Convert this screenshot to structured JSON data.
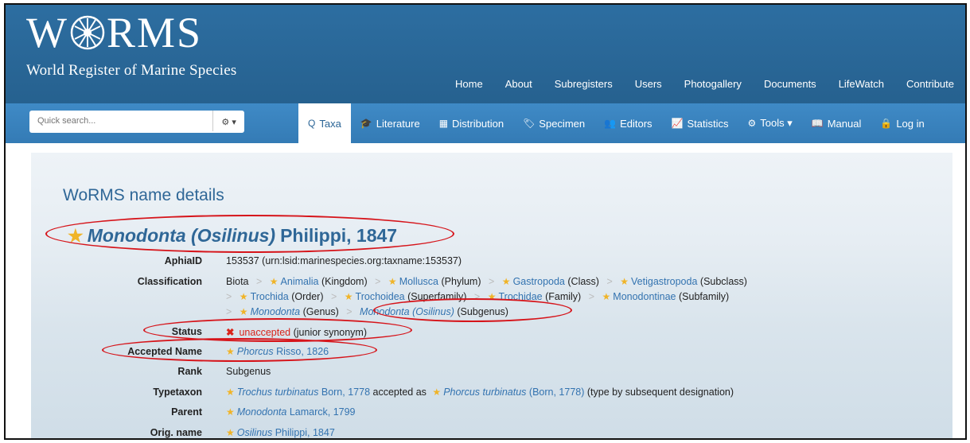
{
  "header": {
    "logo_word_left": "W",
    "logo_word_right": "RMS",
    "logo_subtitle": "World Register of Marine Species",
    "top_nav": [
      "Home",
      "About",
      "Subregisters",
      "Users",
      "Photogallery",
      "Documents",
      "LifeWatch",
      "Contribute"
    ]
  },
  "subnav": {
    "search_placeholder": "Quick search...",
    "gear": "⚙ ▾",
    "tabs": [
      {
        "icon": "Q",
        "label": "Taxa"
      },
      {
        "icon": "🎓",
        "label": "Literature"
      },
      {
        "icon": "▦",
        "label": "Distribution"
      },
      {
        "icon": "🏷",
        "label": "Specimen"
      },
      {
        "icon": "👥",
        "label": "Editors"
      },
      {
        "icon": "📈",
        "label": "Statistics"
      },
      {
        "icon": "⚙",
        "label": "Tools ▾"
      },
      {
        "icon": "📖",
        "label": "Manual"
      },
      {
        "icon": "🔒",
        "label": "Log in"
      }
    ]
  },
  "main": {
    "page_title": "WoRMS name details",
    "name_genus": "Monodonta (Osilinus)",
    "name_author": "Philippi, 1847",
    "aphia_label": "AphiaID",
    "aphia_value": "153537  (urn:lsid:marinespecies.org:taxname:153537)",
    "classification_label": "Classification",
    "classification": {
      "root": "Biota",
      "line1": [
        {
          "name": "Animalia",
          "rank": "(Kingdom)"
        },
        {
          "name": "Mollusca",
          "rank": "(Phylum)"
        },
        {
          "name": "Gastropoda",
          "rank": "(Class)"
        },
        {
          "name": "Vetigastropoda",
          "rank": "(Subclass)"
        }
      ],
      "line2": [
        {
          "name": "Trochida",
          "rank": "(Order)"
        },
        {
          "name": "Trochoidea",
          "rank": "(Superfamily)"
        },
        {
          "name": "Trochidae",
          "rank": "(Family)"
        },
        {
          "name": "Monodontinae",
          "rank": "(Subfamily)"
        }
      ],
      "line3": [
        {
          "name": "Monodonta",
          "rank": "(Genus)"
        },
        {
          "name": "Monodonta (Osilinus)",
          "rank": "(Subgenus)"
        }
      ]
    },
    "status_label": "Status",
    "status_mark": "✖",
    "status_value": "unaccepted",
    "status_note": "(junior synonym)",
    "accepted_label": "Accepted Name",
    "accepted_name": "Phorcus",
    "accepted_author": "Risso, 1826",
    "rank_label": "Rank",
    "rank_value": "Subgenus",
    "typetaxon_label": "Typetaxon",
    "typetaxon_name": "Trochus turbinatus",
    "typetaxon_author": "Born, 1778",
    "typetaxon_mid": "accepted as",
    "typetaxon_acc_name": "Phorcus turbinatus",
    "typetaxon_acc_author": "(Born, 1778)",
    "typetaxon_note": "(type by subsequent designation)",
    "parent_label": "Parent",
    "parent_name": "Monodonta",
    "parent_author": "Lamarck, 1799",
    "orig_label": "Orig. name",
    "orig_name": "Osilinus",
    "orig_author": "Philippi, 1847"
  },
  "colors": {
    "header": "#2a6496",
    "subnav": "#3a84c0",
    "link": "#3373b0",
    "star": "#f0b428",
    "annotation": "#d6141a"
  }
}
